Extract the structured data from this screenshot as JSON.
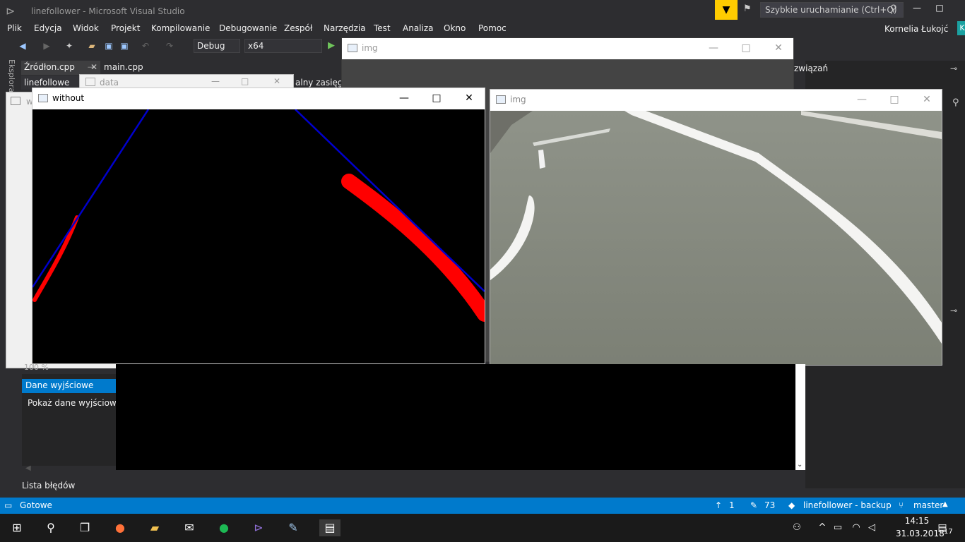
{
  "vs": {
    "title": "linefollower - Microsoft Visual Studio",
    "quick_launch_placeholder": "Szybkie uruchamianie (Ctrl+Q)",
    "user": "Kornelia Łukojć",
    "user_badge": "K",
    "menu": [
      "Plik",
      "Edycja",
      "Widok",
      "Projekt",
      "Kompilowanie",
      "Debugowanie",
      "Zespół",
      "Narzędzia",
      "Test",
      "Analiza",
      "Okno",
      "Pomoc"
    ],
    "config": "Debug",
    "platform": "x64",
    "tabs": [
      "Źródłon.cpp",
      "main.cpp"
    ],
    "side_label": "Eksplora",
    "project_tab": "linefollowe",
    "scope_label": "alny zasięg)",
    "right_panel_title": "związań"
  },
  "windows": {
    "data_title": "data",
    "w_title": "w",
    "without_title": "without",
    "img_title": "img",
    "img_bg_title": "img"
  },
  "output": {
    "zoom": "100 %",
    "selected": "Dane wyjściowe",
    "show_label": "Pokaż dane wyjściowe z",
    "error_list": "Lista błędów"
  },
  "status": {
    "ready": "Gotowe",
    "up_count": "1",
    "edit_count": "73",
    "repo": "linefollower - backup",
    "branch": "master"
  },
  "taskbar": {
    "time": "14:15",
    "date": "31.03.2018",
    "notifications": "17"
  },
  "colors": {
    "vs_bg": "#2d2d30",
    "accent": "#007acc",
    "line_blue": "#0000cc",
    "line_red": "#ff0000"
  }
}
